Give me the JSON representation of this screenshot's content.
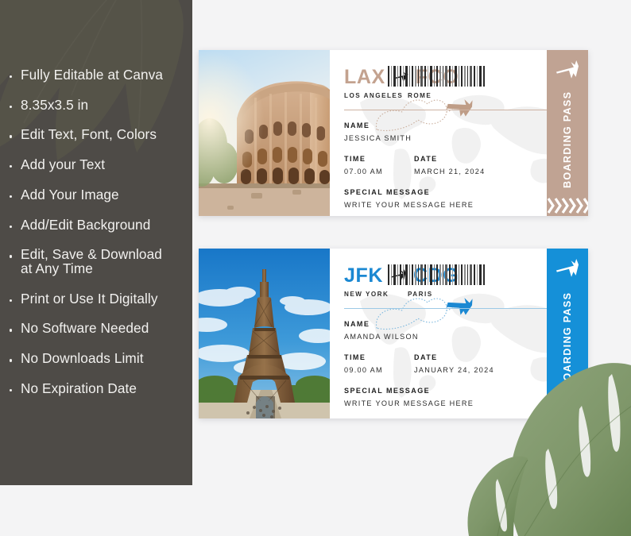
{
  "background": {
    "page_color": "#f4f4f5",
    "panel_color": "#4e4b47",
    "leaf_bottom_right": "monstera-leaf",
    "leaf_panel": "monstera-leaf"
  },
  "panel": {
    "features": [
      "Fully Editable at Canva",
      "8.35x3.5 in",
      "Edit Text, Font, Colors",
      "Add your Text",
      "Add Your Image",
      "Add/Edit Background",
      "Edit, Save & Download\nat Any Time",
      "Print or Use It Digitally",
      "No Software Needed",
      "No Downloads Limit",
      "No Expiration Date"
    ]
  },
  "tickets": [
    {
      "id": "ticket-1",
      "accent_color": "#c0a393",
      "code_color": "#c3a28f",
      "photo": "colosseum-rome",
      "origin_code": "LAX",
      "destination_code": "FCO",
      "origin_city": "LOS ANGELES",
      "destination_city": "ROME",
      "name_label": "NAME",
      "name_value": "JESSICA SMITH",
      "time_label": "TIME",
      "time_value": "07.00 AM",
      "date_label": "DATE",
      "date_value": "MARCH 21, 2024",
      "message_label": "SPECIAL MESSAGE",
      "message_value": "WRITE YOUR MESSAGE HERE",
      "stub_text": "BOARDING PASS"
    },
    {
      "id": "ticket-2",
      "accent_color": "#1590d8",
      "code_color": "#1b88d2",
      "photo": "eiffel-tower-paris",
      "origin_code": "JFK",
      "destination_code": "CDG",
      "origin_city": "NEW YORK",
      "destination_city": "PARIS",
      "name_label": "NAME",
      "name_value": "AMANDA WILSON",
      "time_label": "TIME",
      "time_value": "09.00 AM",
      "date_label": "DATE",
      "date_value": "JANUARY 24, 2024",
      "message_label": "SPECIAL MESSAGE",
      "message_value": "WRITE YOUR MESSAGE HERE",
      "stub_text": "BOARDING PASS"
    }
  ]
}
